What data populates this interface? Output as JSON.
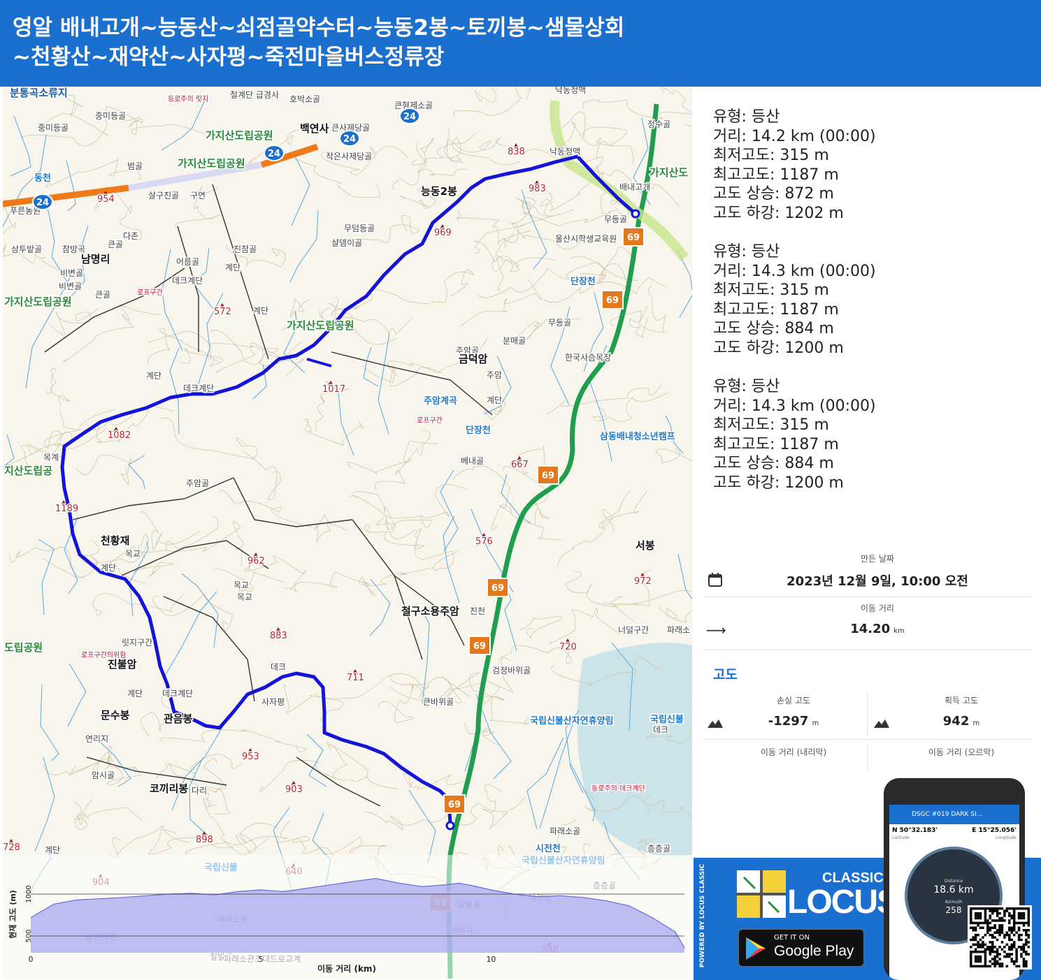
{
  "title": {
    "line1": "영알 배내고개~능동산~쇠점골약수터~능동2봉~토끼봉~샘물상회",
    "line2": "~천황산~재약산~사자평~죽전마을버스정류장"
  },
  "stats": [
    {
      "type": "유형: 등산",
      "distance": "거리: 14.2 km (00:00)",
      "min_alt": "최저고도: 315 m",
      "max_alt": "최고고도: 1187 m",
      "ascent": "고도 상승: 872 m",
      "descent": "고도 하강: 1202 m"
    },
    {
      "type": "유형: 등산",
      "distance": "거리: 14.3 km (00:00)",
      "min_alt": "최저고도: 315 m",
      "max_alt": "최고고도: 1187 m",
      "ascent": "고도 상승: 884 m",
      "descent": "고도 하강: 1200 m"
    },
    {
      "type": "유형: 등산",
      "distance": "거리: 14.3 km (00:00)",
      "min_alt": "최저고도: 315 m",
      "max_alt": "최고고도: 1187 m",
      "ascent": "고도 상승: 884 m",
      "descent": "고도 하강: 1200 m"
    }
  ],
  "info": {
    "created_label": "만든 날짜",
    "created_value": "2023년 12월 9일, 10:00 오전",
    "distance_label": "이동 거리",
    "distance_value": "14.20",
    "distance_unit": "km",
    "altitude_section": "고도",
    "loss_label": "손실 고도",
    "loss_value": "-1297",
    "loss_unit": "m",
    "gain_label": "획득 고도",
    "gain_value": "942",
    "gain_unit": "m",
    "dist_down_label": "이동 거리 (내리막)",
    "dist_up_label": "이동 거리 (오르막)"
  },
  "map_labels": [
    {
      "text": "분통곡소류지",
      "kind": "area"
    },
    {
      "text": "중미등골",
      "kind": "local"
    },
    {
      "text": "등로주의 릿지",
      "kind": "warn"
    },
    {
      "text": "철계단 급경사",
      "kind": "local"
    },
    {
      "text": "호박소골",
      "kind": "local"
    },
    {
      "text": "큰형제소골",
      "kind": "local"
    },
    {
      "text": "낙동정맥",
      "kind": "local"
    },
    {
      "text": "정수골",
      "kind": "local"
    },
    {
      "text": "중미등골",
      "kind": "local"
    },
    {
      "text": "가지산도립공원",
      "kind": "park"
    },
    {
      "text": "백연사",
      "kind": "place"
    },
    {
      "text": "큰사제당골",
      "kind": "local"
    },
    {
      "text": "838",
      "kind": "peak"
    },
    {
      "text": "낙동정맥",
      "kind": "local"
    },
    {
      "text": "가지산도",
      "kind": "park"
    },
    {
      "text": "동천",
      "kind": "river"
    },
    {
      "text": "범골",
      "kind": "local"
    },
    {
      "text": "가지산도립공원",
      "kind": "park"
    },
    {
      "text": "작은사제당골",
      "kind": "local"
    },
    {
      "text": "983",
      "kind": "peak"
    },
    {
      "text": "배내고개",
      "kind": "local"
    },
    {
      "text": "능동2봉",
      "kind": "place"
    },
    {
      "text": "살구진골",
      "kind": "local"
    },
    {
      "text": "구연",
      "kind": "local"
    },
    {
      "text": "푸른농원",
      "kind": "local"
    },
    {
      "text": "무덤등골",
      "kind": "local"
    },
    {
      "text": "무등골",
      "kind": "local"
    },
    {
      "text": "969",
      "kind": "peak"
    },
    {
      "text": "샬뎀이골",
      "kind": "local"
    },
    {
      "text": "울산시학생교육원",
      "kind": "local"
    },
    {
      "text": "상투밭골",
      "kind": "local"
    },
    {
      "text": "참방곡",
      "kind": "local"
    },
    {
      "text": "큰골",
      "kind": "local"
    },
    {
      "text": "진참골",
      "kind": "local"
    },
    {
      "text": "남명리",
      "kind": "place"
    },
    {
      "text": "비변골",
      "kind": "local"
    },
    {
      "text": "어름골",
      "kind": "local"
    },
    {
      "text": "비변골",
      "kind": "local"
    },
    {
      "text": "계단",
      "kind": "local"
    },
    {
      "text": "데크계단",
      "kind": "local"
    },
    {
      "text": "단장천",
      "kind": "river"
    },
    {
      "text": "큰골",
      "kind": "local"
    },
    {
      "text": "로프구간",
      "kind": "warn"
    },
    {
      "text": "가지산도립공원",
      "kind": "park"
    },
    {
      "text": "무등골",
      "kind": "local"
    },
    {
      "text": "572",
      "kind": "peak"
    },
    {
      "text": "계단",
      "kind": "local"
    },
    {
      "text": "가지산도립공원",
      "kind": "park"
    },
    {
      "text": "분매골",
      "kind": "local"
    },
    {
      "text": "주암골",
      "kind": "local"
    },
    {
      "text": "한국사슴목장",
      "kind": "local"
    },
    {
      "text": "금덕암",
      "kind": "place"
    },
    {
      "text": "1017",
      "kind": "peak"
    },
    {
      "text": "계단",
      "kind": "local"
    },
    {
      "text": "데크계단",
      "kind": "local"
    },
    {
      "text": "주암",
      "kind": "local"
    },
    {
      "text": "계단",
      "kind": "local"
    },
    {
      "text": "주암계곡",
      "kind": "river"
    },
    {
      "text": "로프구간",
      "kind": "warn"
    },
    {
      "text": "단장천",
      "kind": "river"
    },
    {
      "text": "삼동배내청소년캠프",
      "kind": "river"
    },
    {
      "text": "1082",
      "kind": "peak"
    },
    {
      "text": "목계",
      "kind": "local"
    },
    {
      "text": "지산도립공",
      "kind": "park"
    },
    {
      "text": "베내골",
      "kind": "local"
    },
    {
      "text": "667",
      "kind": "peak"
    },
    {
      "text": "주암골",
      "kind": "local"
    },
    {
      "text": "1189",
      "kind": "peak"
    },
    {
      "text": "576",
      "kind": "peak"
    },
    {
      "text": "천황재",
      "kind": "place"
    },
    {
      "text": "목교",
      "kind": "local"
    },
    {
      "text": "서봉",
      "kind": "place"
    },
    {
      "text": "계단",
      "kind": "local"
    },
    {
      "text": "962",
      "kind": "peak"
    },
    {
      "text": "972",
      "kind": "peak"
    },
    {
      "text": "목교",
      "kind": "local"
    },
    {
      "text": "목교",
      "kind": "local"
    },
    {
      "text": "철구소용주암",
      "kind": "place"
    },
    {
      "text": "진천",
      "kind": "local"
    },
    {
      "text": "883",
      "kind": "peak"
    },
    {
      "text": "너덜구간",
      "kind": "local"
    },
    {
      "text": "파래소",
      "kind": "local"
    },
    {
      "text": "릿지구간",
      "kind": "local"
    },
    {
      "text": "도립공원",
      "kind": "park"
    },
    {
      "text": "로프구간의위험",
      "kind": "warn"
    },
    {
      "text": "진불암",
      "kind": "place"
    },
    {
      "text": "720",
      "kind": "peak"
    },
    {
      "text": "검정바위골",
      "kind": "local"
    },
    {
      "text": "데크",
      "kind": "local"
    },
    {
      "text": "711",
      "kind": "peak"
    },
    {
      "text": "계단",
      "kind": "local"
    },
    {
      "text": "데크계단",
      "kind": "local"
    },
    {
      "text": "사자평",
      "kind": "local"
    },
    {
      "text": "문수봉",
      "kind": "place"
    },
    {
      "text": "큰바위골",
      "kind": "local"
    },
    {
      "text": "국립신불산자연휴양림",
      "kind": "river"
    },
    {
      "text": "국립신불",
      "kind": "river"
    },
    {
      "text": "관음봉",
      "kind": "place"
    },
    {
      "text": "데크",
      "kind": "local"
    },
    {
      "text": "연리지",
      "kind": "local"
    },
    {
      "text": "953",
      "kind": "peak"
    },
    {
      "text": "암시골",
      "kind": "local"
    },
    {
      "text": "903",
      "kind": "peak"
    },
    {
      "text": "코끼리봉",
      "kind": "place"
    },
    {
      "text": "다리",
      "kind": "local"
    },
    {
      "text": "등로주의 데크계단",
      "kind": "warn"
    },
    {
      "text": "파래소골",
      "kind": "local"
    },
    {
      "text": "898",
      "kind": "peak"
    },
    {
      "text": "728",
      "kind": "peak"
    },
    {
      "text": "계단",
      "kind": "local"
    },
    {
      "text": "시전천",
      "kind": "river"
    },
    {
      "text": "층층골",
      "kind": "local"
    },
    {
      "text": "국립신불산자연휴양림",
      "kind": "river"
    },
    {
      "text": "국립신불",
      "kind": "river"
    },
    {
      "text": "640",
      "kind": "peak"
    },
    {
      "text": "층층골",
      "kind": "local"
    },
    {
      "text": "904",
      "kind": "peak"
    },
    {
      "text": "파래소골",
      "kind": "local"
    },
    {
      "text": "칠발골",
      "kind": "local"
    },
    {
      "text": "태전등",
      "kind": "local"
    },
    {
      "text": "장안백련",
      "kind": "local"
    },
    {
      "text": "백련사",
      "kind": "local"
    },
    {
      "text": "칠발골",
      "kind": "local"
    },
    {
      "text": "파래소관조대드로교계",
      "kind": "local"
    },
    {
      "text": "948",
      "kind": "peak"
    },
    {
      "text": "954",
      "kind": "peak"
    },
    {
      "text": "다촌",
      "kind": "local"
    }
  ],
  "route_shields": [
    "24",
    "24",
    "24",
    "24",
    "69",
    "69",
    "69",
    "69",
    "69",
    "69",
    "69"
  ],
  "elevation_chart": {
    "y_axis_label": "현재 고도 (m)",
    "y_ticks": [
      "1000",
      "500"
    ],
    "x_ticks": [
      "0",
      "5",
      "10"
    ],
    "x_axis_label": "이동 거리 (km)"
  },
  "chart_data": {
    "type": "area",
    "xlabel": "이동 거리 (km)",
    "ylabel": "현재 고도 (m)",
    "xlim": [
      0,
      14.2
    ],
    "ylim": [
      300,
      1200
    ],
    "x": [
      0,
      0.5,
      1.0,
      2.0,
      3.0,
      3.5,
      4.0,
      4.5,
      5.0,
      5.5,
      6.0,
      6.5,
      7.0,
      7.5,
      8.0,
      8.5,
      9.0,
      9.3,
      9.6,
      10.0,
      10.5,
      11.0,
      11.5,
      12.0,
      12.5,
      13.0,
      13.5,
      14.0,
      14.2
    ],
    "y": [
      720,
      880,
      930,
      960,
      1000,
      1010,
      990,
      1030,
      1050,
      1030,
      1070,
      1110,
      1150,
      1187,
      1130,
      1090,
      1110,
      1130,
      1100,
      1050,
      1000,
      970,
      980,
      960,
      920,
      860,
      720,
      550,
      360
    ],
    "grid": true
  },
  "promo": {
    "powered": "POWERED BY LOCUS CLASSIC",
    "classic": "CLASSIC",
    "locus": "LOCUS",
    "get_it_on": "GET IT ON",
    "store": "Google Play",
    "phone_title": "DSGC #019 DARK SI...",
    "lat": "N 50°32.183'",
    "lat_label": "Latitude",
    "lon": "E 15°25.056'",
    "lon_label": "Longitude",
    "distance_label": "Distance",
    "distance_value": "18.6 km",
    "azimuth_label": "Azimuth",
    "azimuth_value": "258"
  },
  "colors": {
    "header": "#1a6fcf",
    "route": "#1414d8",
    "road_green": "#1e9e4e",
    "road_orange": "#f07a1a",
    "shield": "#e4781c",
    "elev_fill": "#a8a8f0"
  }
}
